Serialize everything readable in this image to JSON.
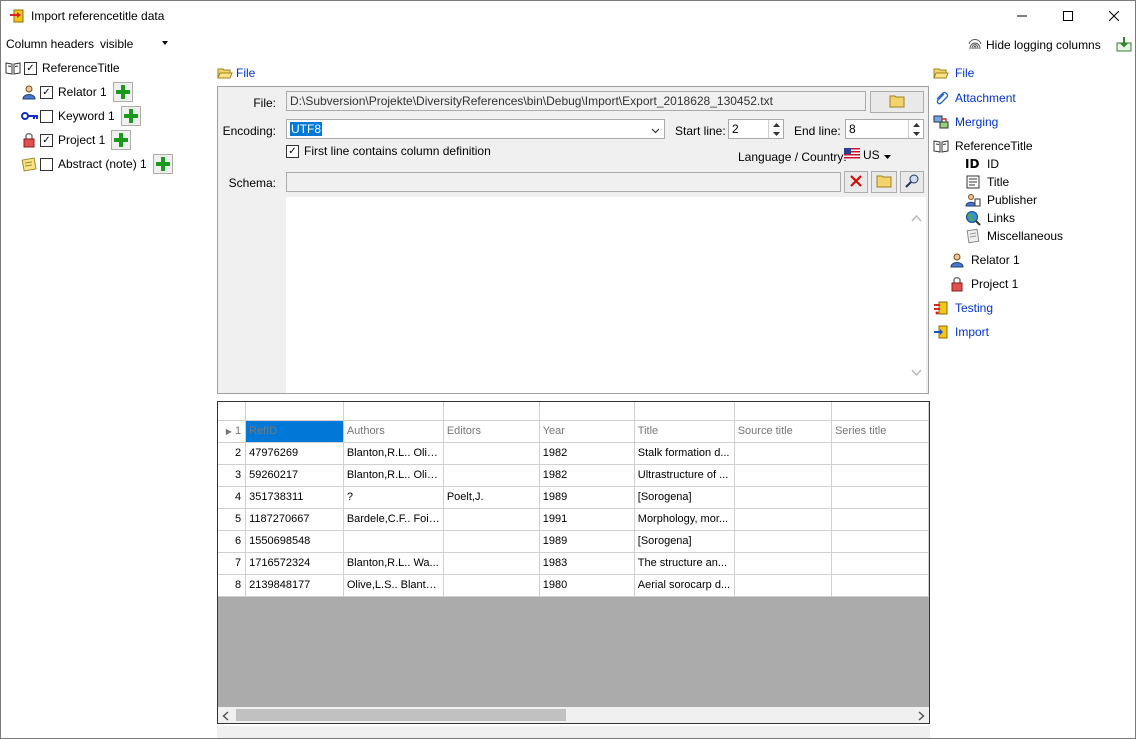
{
  "window": {
    "title": "Import referencetitle data"
  },
  "options": {
    "column_headers_label": "Column headers",
    "column_headers_value": "visible",
    "hide_logging_label": "Hide logging columns"
  },
  "tree": [
    {
      "label": "ReferenceTitle",
      "checked": true,
      "icon": "book-icon",
      "has_add": false
    },
    {
      "label": "Relator 1",
      "checked": true,
      "icon": "person-icon",
      "has_add": true
    },
    {
      "label": "Keyword 1",
      "checked": false,
      "icon": "key-icon",
      "has_add": true
    },
    {
      "label": "Project 1",
      "checked": true,
      "icon": "lock-icon",
      "has_add": true
    },
    {
      "label": "Abstract (note) 1",
      "checked": false,
      "icon": "note-icon",
      "has_add": true
    }
  ],
  "file_section": {
    "heading": "File",
    "file_label": "File:",
    "file_path": "D:\\Subversion\\Projekte\\DiversityReferences\\bin\\Debug\\Import\\Export_2018628_130452.txt",
    "encoding_label": "Encoding:",
    "encoding_value": "UTF8",
    "start_line_label": "Start line:",
    "start_line_value": "2",
    "end_line_label": "End line:",
    "end_line_value": "8",
    "first_line_label": "First line contains column definition",
    "first_line_checked": true,
    "language_label": "Language / Country:",
    "language_value": "US",
    "schema_label": "Schema:",
    "schema_value": ""
  },
  "grid": {
    "columns": [
      "RefID",
      "Authors",
      "Editors",
      "Year",
      "Title",
      "Source title",
      "Series title"
    ],
    "rows": [
      [
        "47976269",
        "Blanton,R.L.. Oliv...",
        "",
        "1982",
        "Stalk formation d...",
        "",
        ""
      ],
      [
        "59260217",
        "Blanton,R.L.. Oliv...",
        "",
        "1982",
        "Ultrastructure of ...",
        "",
        ""
      ],
      [
        "351738311",
        "?",
        "Poelt,J.",
        "1989",
        "[Sorogena]",
        "",
        ""
      ],
      [
        "1187270667",
        "Bardele,C.F.. Fois...",
        "",
        "1991",
        "Morphology, mor...",
        "",
        ""
      ],
      [
        "1550698548",
        "",
        "",
        "1989",
        "[Sorogena]",
        "",
        ""
      ],
      [
        "1716572324",
        "Blanton,R.L.. Wa...",
        "",
        "1983",
        "The structure an...",
        "",
        ""
      ],
      [
        "2139848177",
        "Olive,L.S.. Blanto...",
        "",
        "1980",
        "Aerial sorocarp d...",
        "",
        ""
      ]
    ],
    "row_numbers": [
      "1",
      "2",
      "3",
      "4",
      "5",
      "6",
      "7",
      "8"
    ]
  },
  "nav": [
    {
      "label": "File",
      "link": true,
      "icon": "folder-open-icon",
      "indent": 0
    },
    {
      "label": "Attachment",
      "link": true,
      "icon": "paperclip-icon",
      "indent": 0
    },
    {
      "label": "Merging",
      "link": true,
      "icon": "merge-icon",
      "indent": 0
    },
    {
      "label": "ReferenceTitle",
      "link": false,
      "icon": "book-icon",
      "indent": 0
    },
    {
      "label": "ID",
      "link": false,
      "icon": "id-icon",
      "indent": 1
    },
    {
      "label": "Title",
      "link": false,
      "icon": "title-icon",
      "indent": 1
    },
    {
      "label": "Publisher",
      "link": false,
      "icon": "publisher-icon",
      "indent": 1
    },
    {
      "label": "Links",
      "link": false,
      "icon": "globe-icon",
      "indent": 1
    },
    {
      "label": "Miscellaneous",
      "link": false,
      "icon": "misc-icon",
      "indent": 1
    },
    {
      "label": "Relator 1",
      "link": false,
      "icon": "person-icon",
      "indent": 0.5
    },
    {
      "label": "Project 1",
      "link": false,
      "icon": "lock-icon",
      "indent": 0.5
    },
    {
      "label": "Testing",
      "link": true,
      "icon": "testing-icon",
      "indent": 0
    },
    {
      "label": "Import",
      "link": true,
      "icon": "import-icon",
      "indent": 0
    }
  ]
}
